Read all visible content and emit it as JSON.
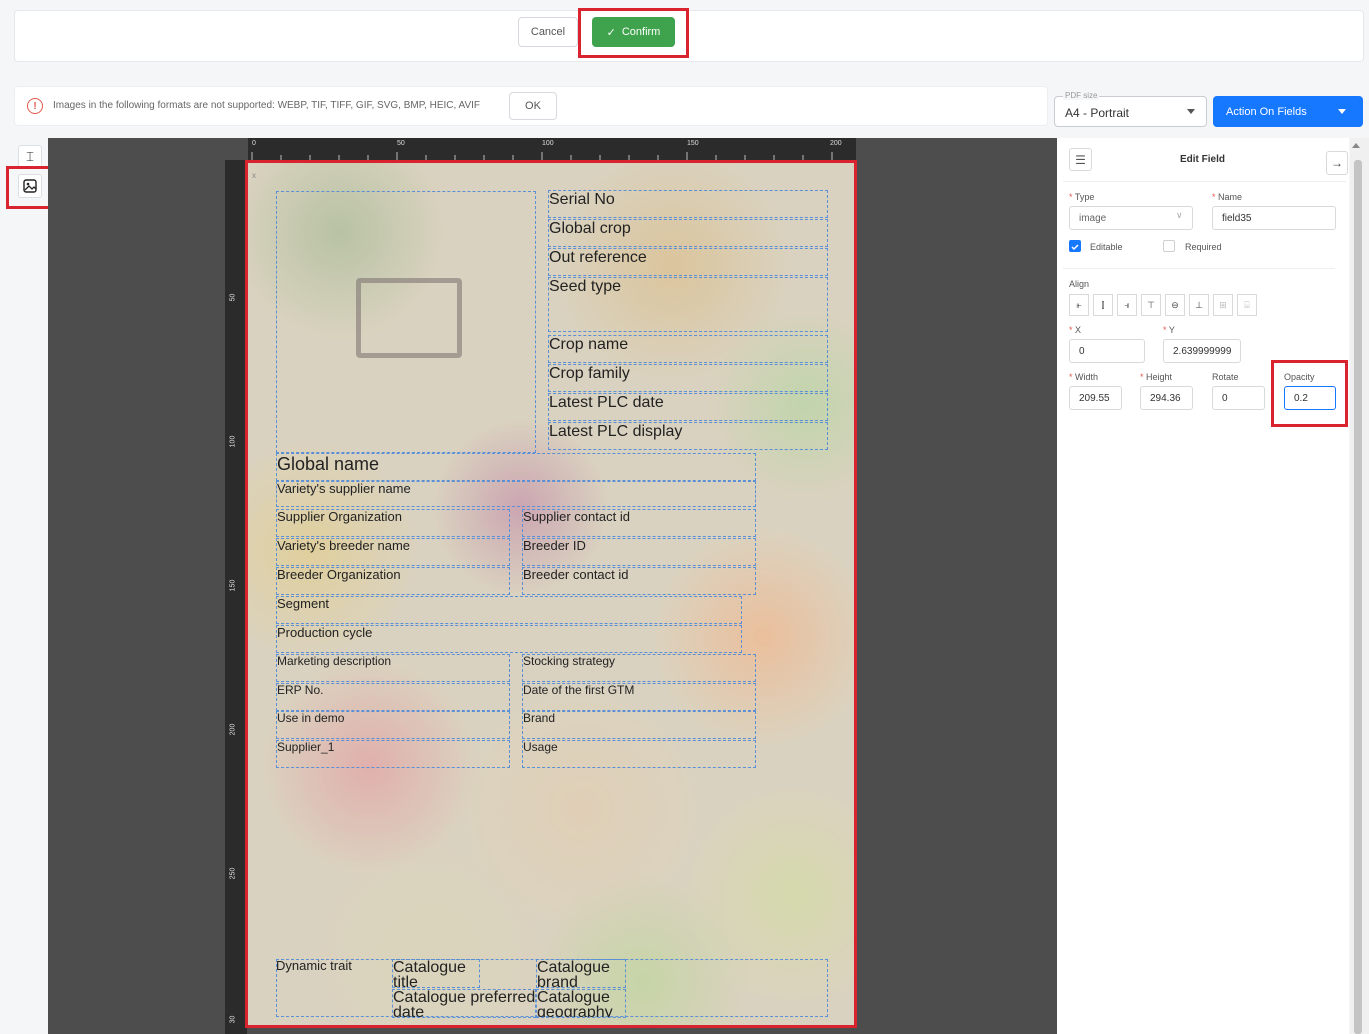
{
  "topbar": {
    "cancel_label": "Cancel",
    "confirm_label": "Confirm"
  },
  "warning": {
    "text": "Images in the following formats are not supported: WEBP, TIF, TIFF, GIF, SVG, BMP, HEIC, AVIF",
    "ok_label": "OK"
  },
  "pdf_size": {
    "legend": "PDF size",
    "value": "A4 - Portrait"
  },
  "action_on_fields": {
    "label": "Action On Fields"
  },
  "ruler": {
    "horizontal": [
      "0",
      "50",
      "100",
      "150",
      "200"
    ],
    "vertical": [
      "50",
      "100",
      "150",
      "200",
      "250",
      "30"
    ]
  },
  "page": {
    "close_mark": "x",
    "fields": {
      "serial_no": "Serial No",
      "global_crop": "Global crop",
      "out_reference": "Out reference",
      "seed_type": "Seed type",
      "crop_name": "Crop name",
      "crop_family": "Crop family",
      "latest_plc_date": "Latest PLC date",
      "latest_plc_display": "Latest PLC display",
      "global_name": "Global name",
      "variety_supplier_name": "Variety's supplier name",
      "supplier_organization": "Supplier Organization",
      "supplier_contact_id": "Supplier contact id",
      "variety_breeder_name": "Variety's breeder name",
      "breeder_id": "Breeder ID",
      "breeder_organization": "Breeder Organization",
      "breeder_contact_id": "Breeder contact id",
      "segment": "Segment",
      "production_cycle": "Production cycle",
      "marketing_description": "Marketing description",
      "stocking_strategy": "Stocking strategy",
      "erp_no": "ERP No.",
      "date_first_gtm": "Date of the first GTM",
      "use_in_demo": "Use in demo",
      "brand": "Brand",
      "supplier_1": "Supplier_1",
      "usage": "Usage",
      "dynamic_trait": "Dynamic trait",
      "catalogue_title_1": "Catalogue",
      "catalogue_title_2": "title",
      "catalogue_brand_1": "Catalogue",
      "catalogue_brand_2": "brand",
      "catalogue_preferred_date_1": "Catalogue preferred",
      "catalogue_preferred_date_2": "date",
      "catalogue_geography_1": "Catalogue",
      "catalogue_geography_2": "geography"
    }
  },
  "edit_panel": {
    "title": "Edit Field",
    "type_label": "Type",
    "type_value": "image",
    "name_label": "Name",
    "name_value": "field35",
    "editable_label": "Editable",
    "editable_checked": true,
    "required_label": "Required",
    "required_checked": false,
    "align_label": "Align",
    "x_label": "X",
    "x_value": "0",
    "y_label": "Y",
    "y_value": "2.639999999",
    "width_label": "Width",
    "width_value": "209.55",
    "height_label": "Height",
    "height_value": "294.36",
    "rotate_label": "Rotate",
    "rotate_value": "0",
    "opacity_label": "Opacity",
    "opacity_value": "0.2"
  },
  "colors": {
    "confirm": "#3fa34d",
    "primary": "#1677ff",
    "highlight": "#d9232e",
    "warning": "#e2574c"
  }
}
